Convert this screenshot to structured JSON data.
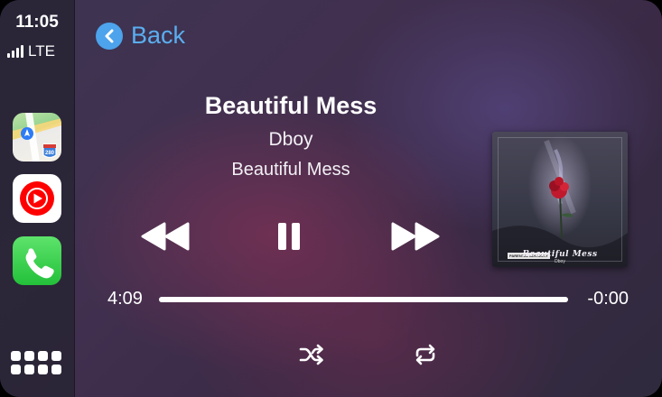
{
  "status_bar": {
    "time": "11:05",
    "network": "LTE",
    "signal_bars": 4
  },
  "sidebar": {
    "apps": [
      {
        "name": "Maps",
        "icon": "maps-icon"
      },
      {
        "name": "YouTube Music",
        "icon": "youtube-music-icon"
      },
      {
        "name": "Phone",
        "icon": "phone-icon"
      }
    ],
    "home_icon": "app-grid-icon"
  },
  "nav": {
    "back_label": "Back",
    "back_icon": "chevron-left-icon"
  },
  "now_playing": {
    "title": "Beautiful Mess",
    "artist": "Dboy",
    "album": "Beautiful Mess",
    "artwork": {
      "title": "Beautiful Mess",
      "artist": "Dboy",
      "badge": "PARENTAL ADVISORY"
    }
  },
  "controls": {
    "rewind_icon": "rewind-icon",
    "pause_icon": "pause-icon",
    "forward_icon": "fast-forward-icon",
    "shuffle_icon": "shuffle-icon",
    "repeat_icon": "repeat-icon"
  },
  "progress": {
    "elapsed": "4:09",
    "remaining": "-0:00",
    "fraction": 1.0
  },
  "colors": {
    "accent": "#4da3ec",
    "text": "#ffffff",
    "phone_green": "#2ecb48",
    "ytm_red": "#ff0000"
  }
}
